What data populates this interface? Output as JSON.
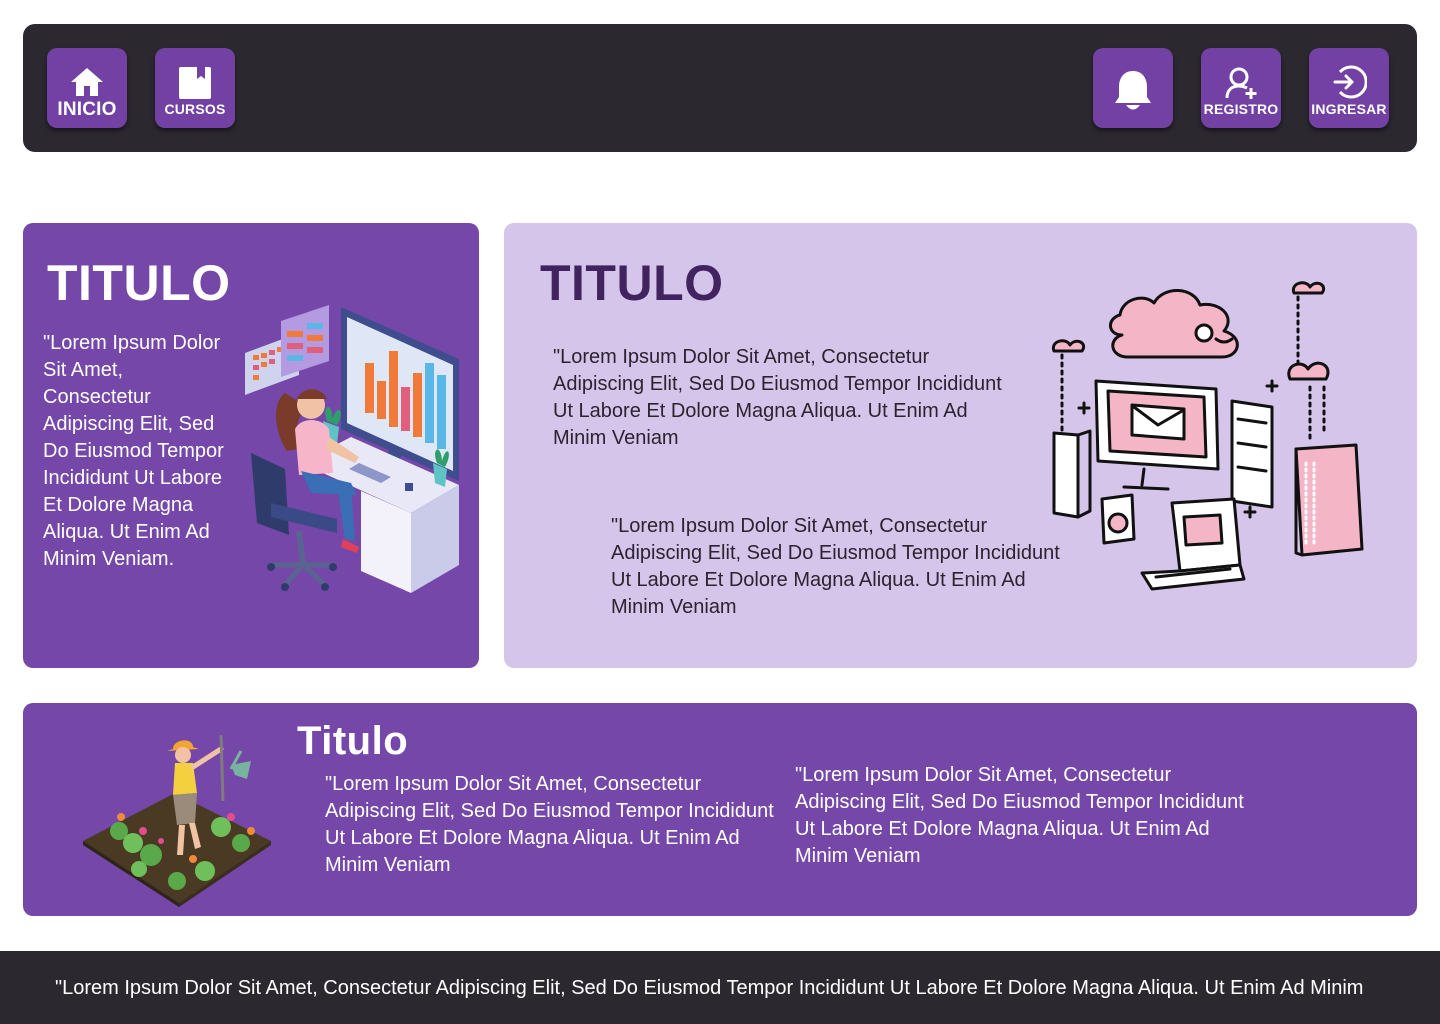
{
  "header": {
    "left_nav": [
      {
        "label": "INICIO",
        "icon": "home-icon"
      },
      {
        "label": "CURSOS",
        "icon": "book-icon"
      }
    ],
    "right_nav": [
      {
        "label": "",
        "icon": "bell-icon"
      },
      {
        "label": "REGISTRO",
        "icon": "user-plus-icon"
      },
      {
        "label": "INGRESAR",
        "icon": "login-icon"
      }
    ]
  },
  "colors": {
    "header_bg": "#2b282f",
    "accent": "#7547a8",
    "card_light": "#d6c5ea",
    "title_dark": "#41235f"
  },
  "card_a": {
    "title": "TITULO",
    "text": "\"Lorem Ipsum Dolor Sit Amet, Consectetur Adipiscing Elit, Sed Do Eiusmod Tempor Incididunt Ut Labore Et Dolore Magna Aliqua. Ut Enim Ad Minim Veniam.",
    "illustration": "person-at-computer-illustration"
  },
  "card_b": {
    "title": "TITULO",
    "text_1": "\"Lorem Ipsum Dolor Sit Amet, Consectetur Adipiscing Elit, Sed Do Eiusmod Tempor Incididunt Ut Labore Et Dolore Magna Aliqua. Ut Enim Ad Minim Veniam",
    "text_2": "\"Lorem Ipsum Dolor Sit Amet, Consectetur Adipiscing Elit, Sed Do Eiusmod Tempor Incididunt Ut Labore Et Dolore Magna Aliqua. Ut Enim Ad Minim Veniam",
    "illustration": "cloud-computing-illustration"
  },
  "card_c": {
    "title": "Titulo",
    "text_1": "\"Lorem Ipsum Dolor Sit Amet, Consectetur Adipiscing Elit, Sed Do Eiusmod Tempor Incididunt Ut Labore Et Dolore Magna Aliqua. Ut Enim Ad Minim Veniam",
    "text_2": "\"Lorem Ipsum Dolor Sit Amet, Consectetur Adipiscing Elit, Sed Do Eiusmod Tempor Incididunt Ut Labore Et Dolore Magna Aliqua. Ut Enim Ad Minim Veniam",
    "illustration": "gardener-illustration"
  },
  "footer": {
    "text": "\"Lorem Ipsum Dolor Sit Amet, Consectetur Adipiscing Elit, Sed Do Eiusmod Tempor Incididunt Ut Labore Et Dolore Magna Aliqua. Ut Enim Ad Minim"
  }
}
